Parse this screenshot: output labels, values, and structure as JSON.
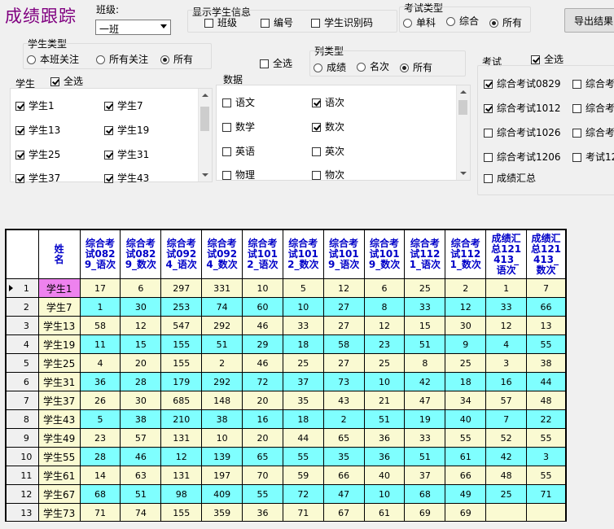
{
  "app_title": "成绩跟踪",
  "class_selector": {
    "label": "班级:",
    "value": "一班"
  },
  "show_student_info": {
    "title": "显示学生信息",
    "options": [
      {
        "label": "班级",
        "checked": false
      },
      {
        "label": "编号",
        "checked": false
      },
      {
        "label": "学生识别码",
        "checked": false
      }
    ]
  },
  "exam_type": {
    "title": "考试类型",
    "options": [
      {
        "label": "单科",
        "checked": false
      },
      {
        "label": "综合",
        "checked": false
      },
      {
        "label": "所有",
        "checked": true
      }
    ]
  },
  "export_button": "导出结果",
  "student_type": {
    "title": "学生类型",
    "options": [
      {
        "label": "本班关注",
        "checked": false
      },
      {
        "label": "所有关注",
        "checked": false
      },
      {
        "label": "所有",
        "checked": true
      }
    ]
  },
  "data_select_all": {
    "label": "全选",
    "checked": false
  },
  "column_type": {
    "title": "列类型",
    "options": [
      {
        "label": "成绩",
        "checked": false
      },
      {
        "label": "名次",
        "checked": false
      },
      {
        "label": "所有",
        "checked": true
      }
    ]
  },
  "students_panel": {
    "title": "学生",
    "select_all": {
      "label": "全选",
      "checked": true
    },
    "items": [
      {
        "label": "学生1",
        "checked": true
      },
      {
        "label": "学生7",
        "checked": true
      },
      {
        "label": "学生13",
        "checked": true
      },
      {
        "label": "学生19",
        "checked": true
      },
      {
        "label": "学生25",
        "checked": true
      },
      {
        "label": "学生31",
        "checked": true
      },
      {
        "label": "学生37",
        "checked": true
      },
      {
        "label": "学生43",
        "checked": true
      }
    ]
  },
  "data_panel": {
    "title": "数据",
    "items": [
      {
        "label": "语文",
        "checked": false
      },
      {
        "label": "语次",
        "checked": true
      },
      {
        "label": "数学",
        "checked": false
      },
      {
        "label": "数次",
        "checked": true
      },
      {
        "label": "英语",
        "checked": false
      },
      {
        "label": "英次",
        "checked": false
      },
      {
        "label": "物理",
        "checked": false
      },
      {
        "label": "物次",
        "checked": false
      }
    ]
  },
  "exams_panel": {
    "title": "考试",
    "select_all": {
      "label": "全选",
      "checked": true
    },
    "items": [
      {
        "label": "综合考试0829",
        "checked": true
      },
      {
        "label": "综合考",
        "checked": false
      },
      {
        "label": "综合考试1012",
        "checked": true
      },
      {
        "label": "综合考",
        "checked": false
      },
      {
        "label": "综合考试1026",
        "checked": false
      },
      {
        "label": "综合考",
        "checked": false
      },
      {
        "label": "综合考试1206",
        "checked": false
      },
      {
        "label": "考试12",
        "checked": false
      },
      {
        "label": "成绩汇总",
        "checked": false
      }
    ]
  },
  "grid": {
    "name_header": "姓名",
    "columns": [
      "综合考试0829_语次",
      "综合考试0829_数次",
      "综合考试0924_语次",
      "综合考试0924_数次",
      "综合考试1012_语次",
      "综合考试1012_数次",
      "综合考试1019_语次",
      "综合考试1019_数次",
      "综合考试1121_语次",
      "综合考试1121_数次",
      "成绩汇总121413_语次",
      "成绩汇总121413_数次"
    ],
    "rows": [
      {
        "n": "1",
        "name": "学生1",
        "v": [
          "17",
          "6",
          "297",
          "331",
          "10",
          "5",
          "12",
          "6",
          "25",
          "2",
          "1",
          "7"
        ]
      },
      {
        "n": "2",
        "name": "学生7",
        "v": [
          "1",
          "30",
          "253",
          "74",
          "60",
          "10",
          "27",
          "8",
          "33",
          "12",
          "33",
          "66"
        ]
      },
      {
        "n": "3",
        "name": "学生13",
        "v": [
          "58",
          "12",
          "547",
          "292",
          "46",
          "33",
          "27",
          "12",
          "15",
          "30",
          "12",
          "13"
        ]
      },
      {
        "n": "4",
        "name": "学生19",
        "v": [
          "11",
          "15",
          "155",
          "51",
          "29",
          "18",
          "58",
          "23",
          "51",
          "9",
          "4",
          "55"
        ]
      },
      {
        "n": "5",
        "name": "学生25",
        "v": [
          "4",
          "20",
          "155",
          "2",
          "46",
          "25",
          "27",
          "25",
          "8",
          "25",
          "3",
          "38"
        ]
      },
      {
        "n": "6",
        "name": "学生31",
        "v": [
          "36",
          "28",
          "179",
          "292",
          "72",
          "37",
          "73",
          "10",
          "42",
          "18",
          "16",
          "44"
        ]
      },
      {
        "n": "7",
        "name": "学生37",
        "v": [
          "26",
          "30",
          "685",
          "148",
          "20",
          "35",
          "43",
          "21",
          "47",
          "34",
          "57",
          "48"
        ]
      },
      {
        "n": "8",
        "name": "学生43",
        "v": [
          "5",
          "38",
          "210",
          "38",
          "16",
          "18",
          "2",
          "51",
          "19",
          "40",
          "7",
          "22"
        ]
      },
      {
        "n": "9",
        "name": "学生49",
        "v": [
          "23",
          "57",
          "131",
          "10",
          "20",
          "44",
          "65",
          "36",
          "33",
          "55",
          "52",
          "55"
        ]
      },
      {
        "n": "10",
        "name": "学生55",
        "v": [
          "28",
          "46",
          "12",
          "139",
          "65",
          "55",
          "35",
          "36",
          "51",
          "61",
          "42",
          "3"
        ]
      },
      {
        "n": "11",
        "name": "学生61",
        "v": [
          "14",
          "63",
          "131",
          "197",
          "70",
          "59",
          "66",
          "40",
          "37",
          "66",
          "48",
          "55"
        ]
      },
      {
        "n": "12",
        "name": "学生67",
        "v": [
          "68",
          "51",
          "98",
          "409",
          "55",
          "72",
          "47",
          "10",
          "68",
          "49",
          "25",
          "71"
        ]
      },
      {
        "n": "13",
        "name": "学生73",
        "v": [
          "71",
          "74",
          "155",
          "359",
          "36",
          "71",
          "67",
          "61",
          "69",
          "69",
          "",
          ""
        ]
      }
    ]
  }
}
